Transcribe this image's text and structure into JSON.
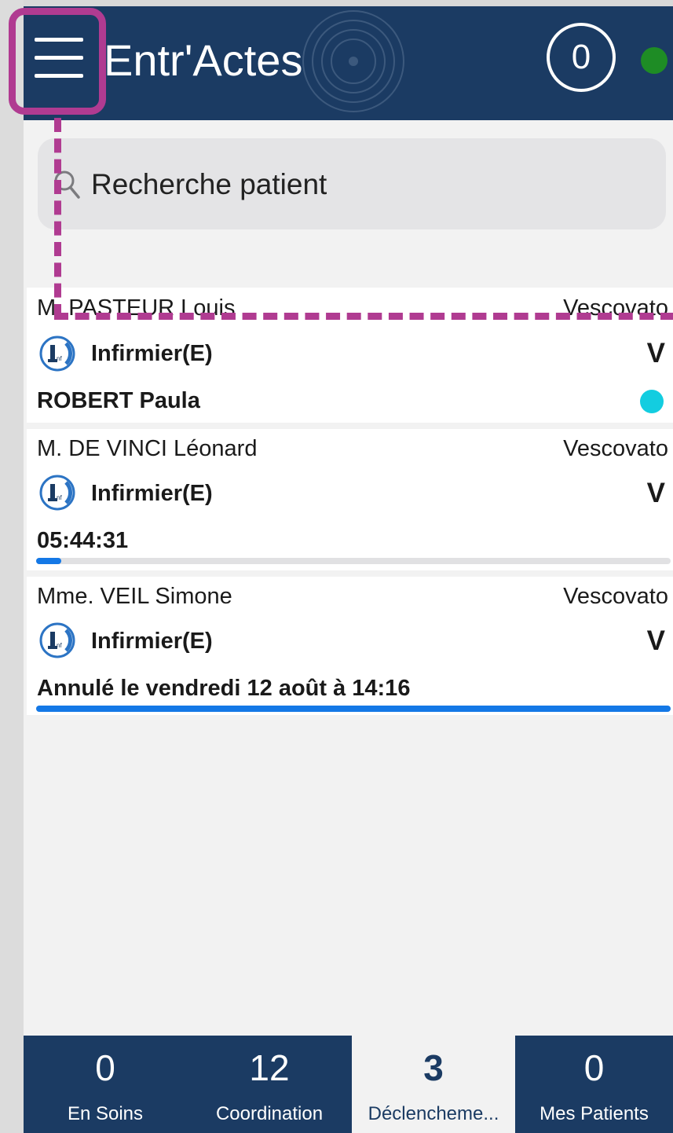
{
  "header": {
    "title": "Entr'Actes",
    "counter": "0",
    "status_color": "#1e8c25",
    "background": "#1b3b63"
  },
  "search": {
    "placeholder": "Recherche patient"
  },
  "patients": [
    {
      "name": "M. PASTEUR Louis",
      "city": "Vescovato",
      "profession": "Infirmier(E)",
      "badge": "V",
      "footer": "ROBERT Paula",
      "status_dot": "cyan"
    },
    {
      "name": "M. DE VINCI Léonard",
      "city": "Vescovato",
      "profession": "Infirmier(E)",
      "badge": "V",
      "footer": "05:44:31",
      "progress": 0.04
    },
    {
      "name": "Mme. VEIL Simone",
      "city": "Vescovato",
      "profession": "Infirmier(E)",
      "badge": "V",
      "footer": "Annulé le vendredi 12 août à 14:16",
      "progress": 1.0
    }
  ],
  "tabs": [
    {
      "count": "0",
      "label": "En Soins",
      "active": false
    },
    {
      "count": "12",
      "label": "Coordination",
      "active": false
    },
    {
      "count": "3",
      "label": "Déclencheme...",
      "active": true
    },
    {
      "count": "0",
      "label": "Mes Patients",
      "active": false
    }
  ],
  "annotation_color": "#b03b91"
}
